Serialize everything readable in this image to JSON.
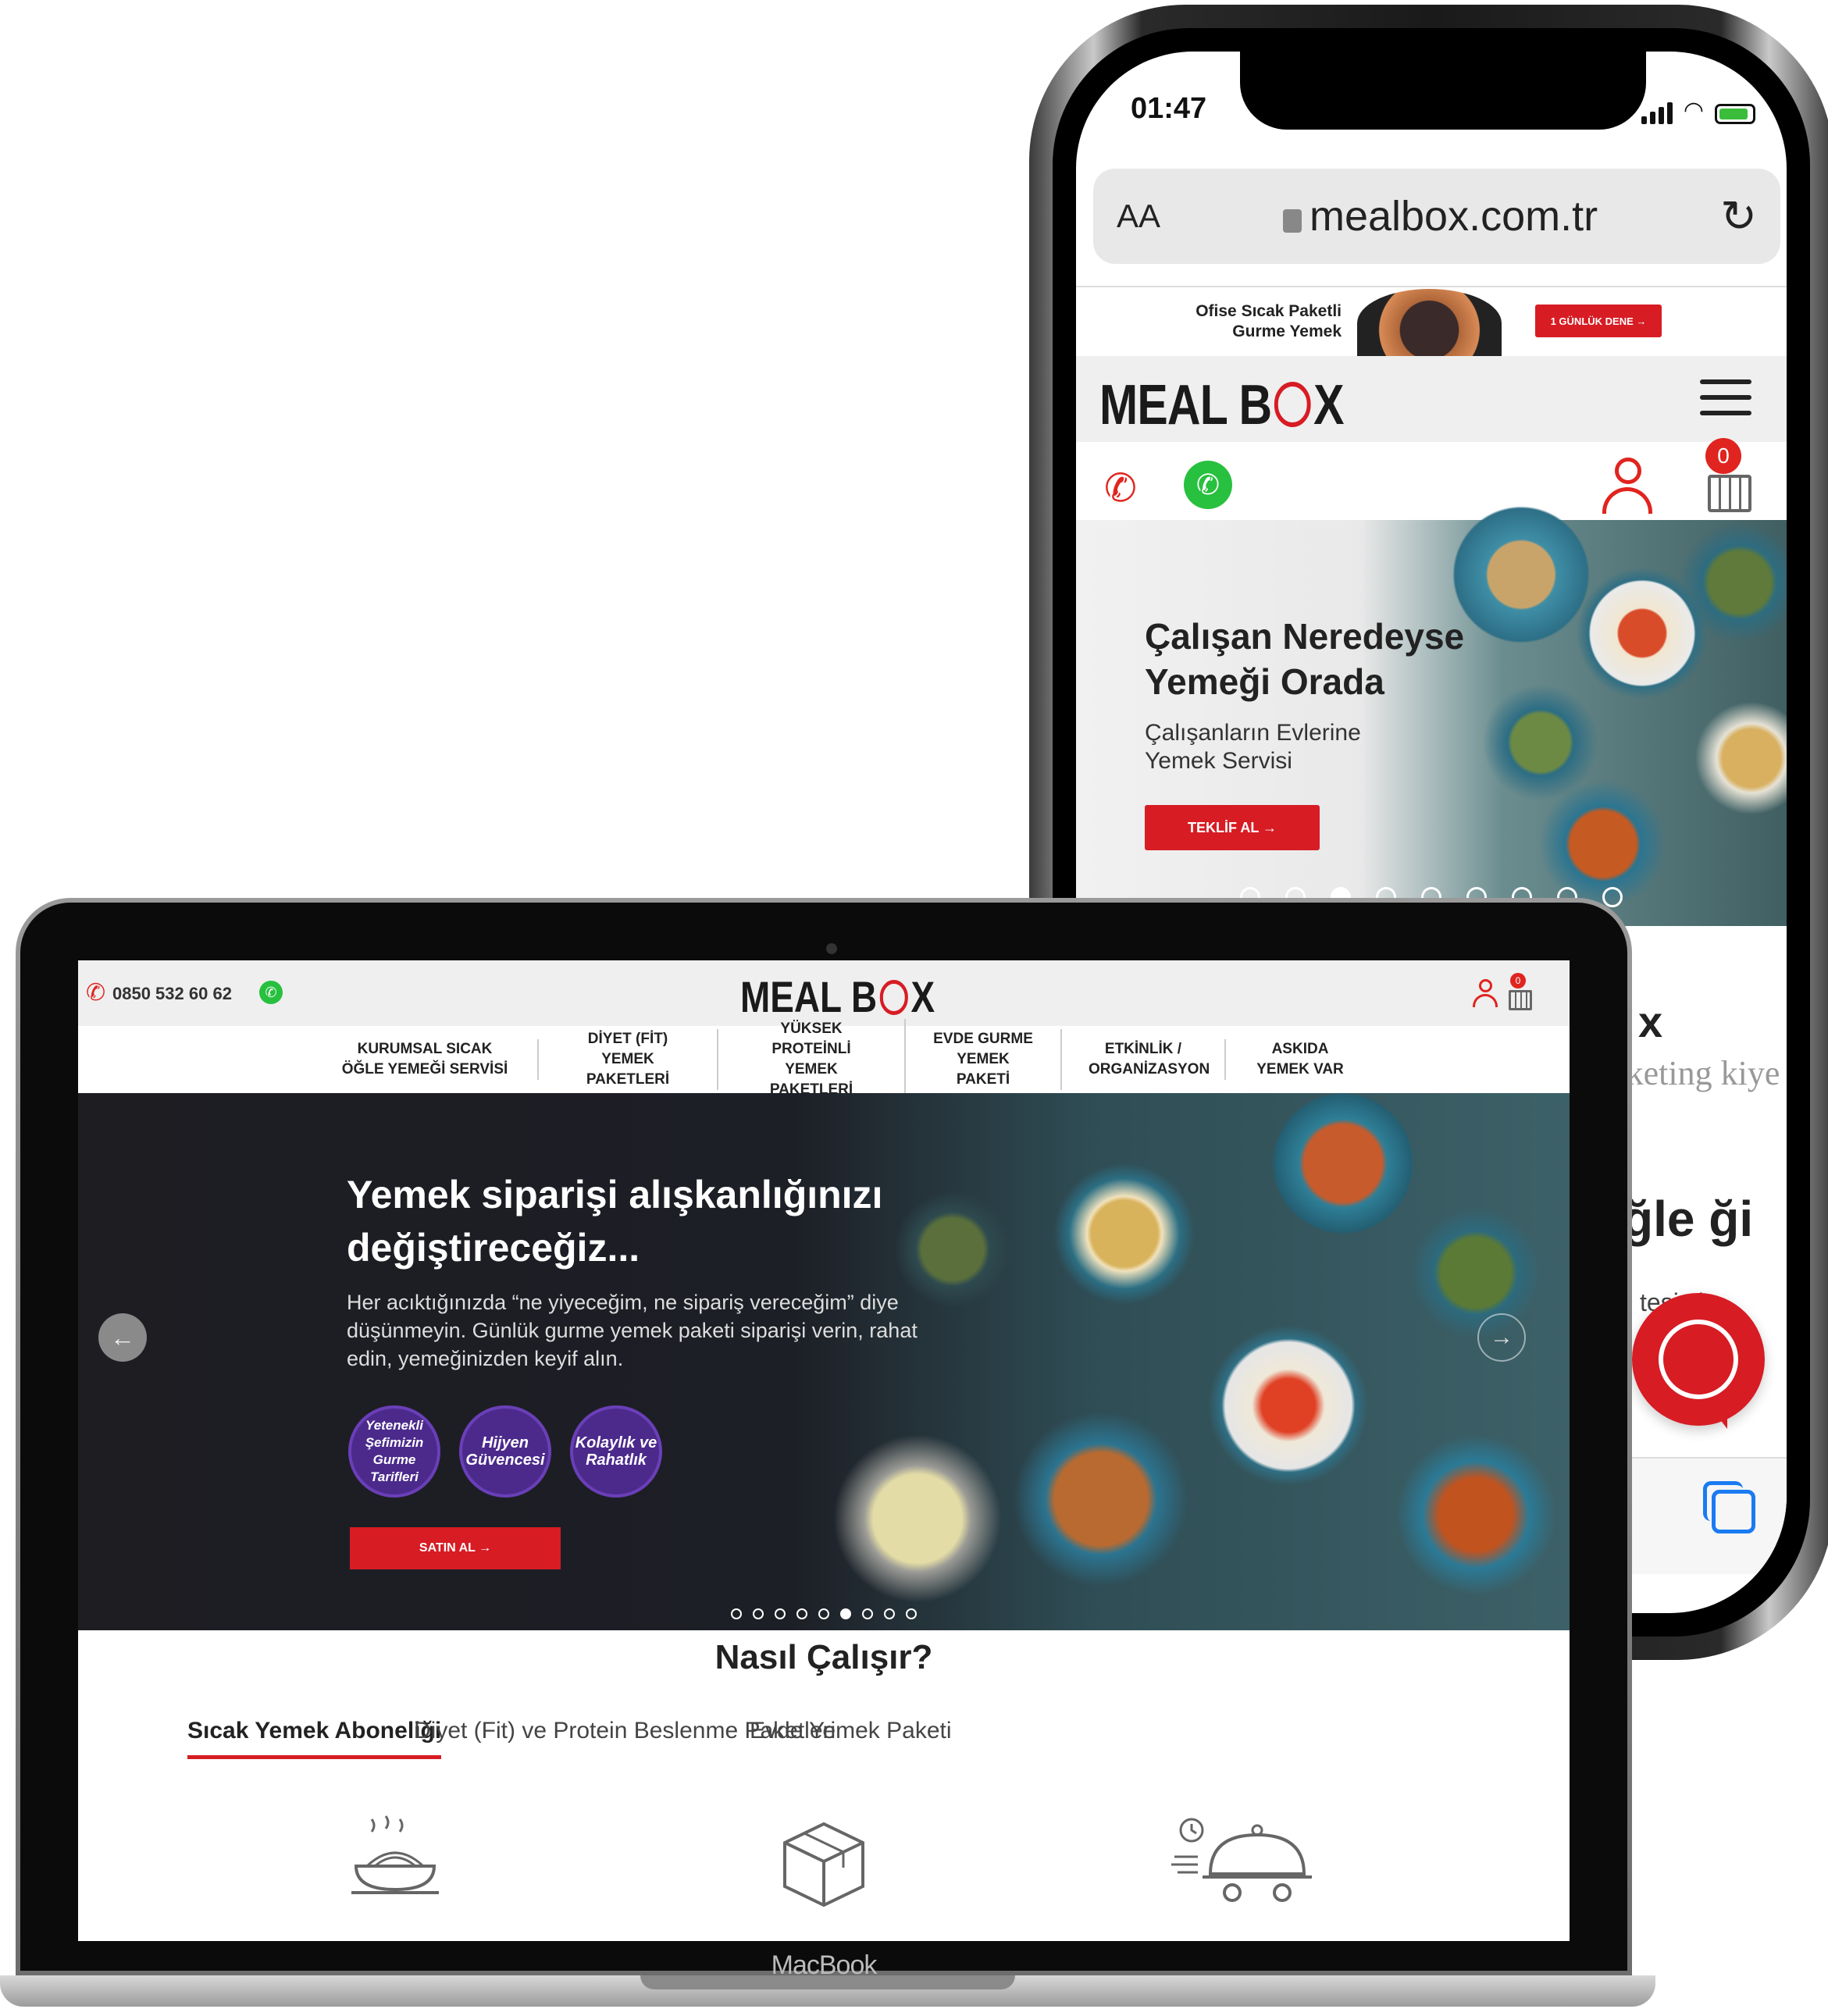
{
  "phone": {
    "status": {
      "time": "01:47"
    },
    "browser": {
      "text_size_label": "AA",
      "url": "mealbox.com.tr",
      "reload_icon": "reload-icon"
    },
    "promo": {
      "text": "Ofise Sıcak Paketli Gurme Yemek",
      "button": "1 GÜNLÜK DENE →"
    },
    "header": {
      "logo": "MEAL BOX",
      "menu_icon": "hamburger-menu-icon"
    },
    "iconbar": {
      "cart_count": "0"
    },
    "hero": {
      "title": "Çalışan Neredeyse Yemeği Orada",
      "subtitle": "Çalışanların Evlerine Yemek Servisi",
      "button": "TEKLİF AL →",
      "dots_total": 9,
      "dots_active": 2
    },
    "below": {
      "fragment1": "x",
      "fragment2": "rketing kiye",
      "fragment3": "ğle ği",
      "fragment4": "iş tesi si."
    }
  },
  "laptop": {
    "device_label": "MacBook",
    "topbar": {
      "phone_number": "0850 532 60 62",
      "logo": "MEAL BOX",
      "cart_count": "0"
    },
    "nav": [
      "KURUMSAL SICAK ÖĞLE YEMEĞİ SERVİSİ",
      "DİYET (FİT) YEMEK PAKETLERİ",
      "YÜKSEK PROTEİNLİ YEMEK PAKETLERİ",
      "EVDE GURME YEMEK PAKETİ",
      "ETKİNLİK / ORGANİZASYON",
      "ASKIDA YEMEK VAR"
    ],
    "hero": {
      "title": "Yemek siparişi alışkanlığınızı değiştireceğiz...",
      "subtitle": "Her acıktığınızda “ne yiyeceğim, ne sipariş vereceğim” diye düşünmeyin. Günlük gurme yemek paketi siparişi verin, rahat edin, yemeğinizden keyif alın.",
      "badges": [
        "Yetenekli Şefimizin Gurme Tarifleri",
        "Hijyen Güvencesi",
        "Kolaylık ve Rahatlık"
      ],
      "button": "SATIN AL →",
      "dots_total": 9,
      "dots_active": 5
    },
    "how": {
      "title": "Nasıl Çalışır?",
      "tabs": [
        "Sıcak Yemek Aboneliği",
        "Diyet (Fit) ve Protein Beslenme Paketleri",
        "Evde Yemek Paketi"
      ],
      "active_tab": 0,
      "step_icons": [
        "hot-food-bowl-icon",
        "box-package-icon",
        "delivery-cloche-icon"
      ]
    }
  },
  "colors": {
    "brand_red": "#d71c24",
    "whatsapp_green": "#27c03f",
    "badge_purple": "#4b2a8c"
  }
}
